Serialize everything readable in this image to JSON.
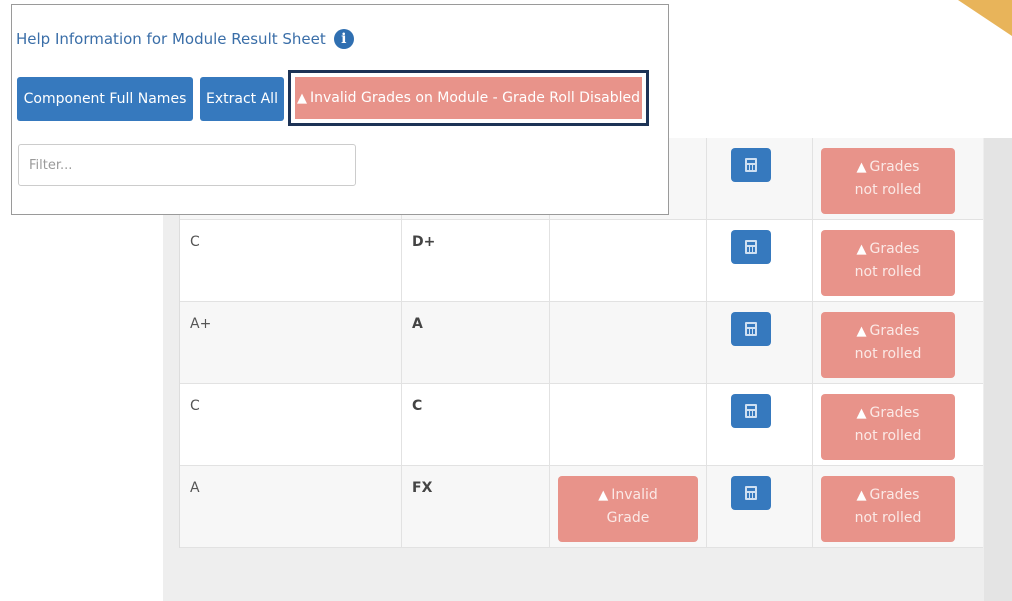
{
  "help": {
    "title": "Help Information for Module Result Sheet",
    "info_glyph": "i",
    "buttons": {
      "component_names": "Component Full Names",
      "extract_all": "Extract All",
      "invalid_grades": "Invalid Grades on Module - Grade Roll Disabled"
    },
    "filter_placeholder": "Filter..."
  },
  "warning_glyph": "▲",
  "rows": [
    {
      "grade_a": "",
      "grade_b": "",
      "invalid": "",
      "status_line1": "Grades",
      "status_line2": "not rolled"
    },
    {
      "grade_a": "C",
      "grade_b": "D+",
      "invalid": "",
      "status_line1": "Grades",
      "status_line2": "not rolled"
    },
    {
      "grade_a": "A+",
      "grade_b": "A",
      "invalid": "",
      "status_line1": "Grades",
      "status_line2": "not rolled"
    },
    {
      "grade_a": "C",
      "grade_b": "C",
      "invalid": "",
      "status_line1": "Grades",
      "status_line2": "not rolled"
    },
    {
      "grade_a": "A",
      "grade_b": "FX",
      "invalid_line1": "Invalid",
      "invalid_line2": "Grade",
      "status_line1": "Grades",
      "status_line2": "not rolled"
    }
  ],
  "colors": {
    "primary": "#3679be",
    "danger_muted": "#e8938a",
    "highlight_border": "#1d3356",
    "corner_accent": "#e8b45a"
  }
}
